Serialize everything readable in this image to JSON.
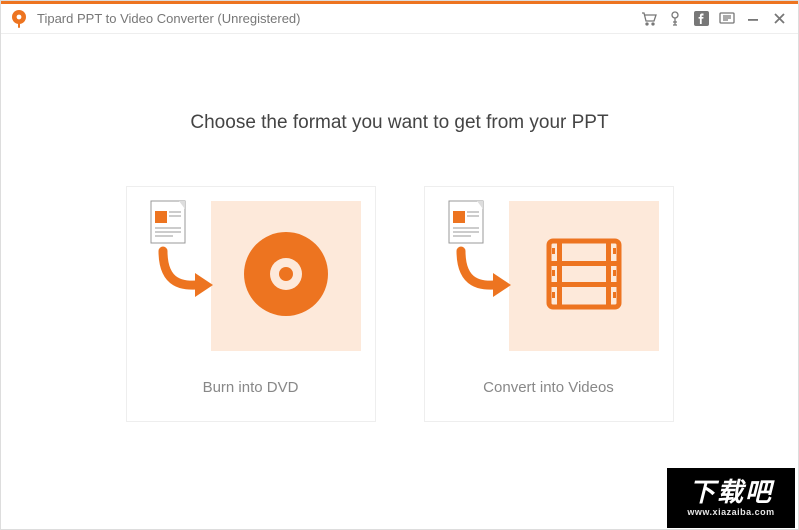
{
  "title": "Tipard PPT to Video Converter (Unregistered)",
  "heading": "Choose the format you want to get from your PPT",
  "cards": {
    "dvd": {
      "label": "Burn into DVD"
    },
    "video": {
      "label": "Convert into Videos"
    }
  },
  "watermark": {
    "text": "下载吧",
    "url": "www.xiazaiba.com"
  },
  "colors": {
    "accent": "#ED7420",
    "tile": "#FDE9DA"
  }
}
